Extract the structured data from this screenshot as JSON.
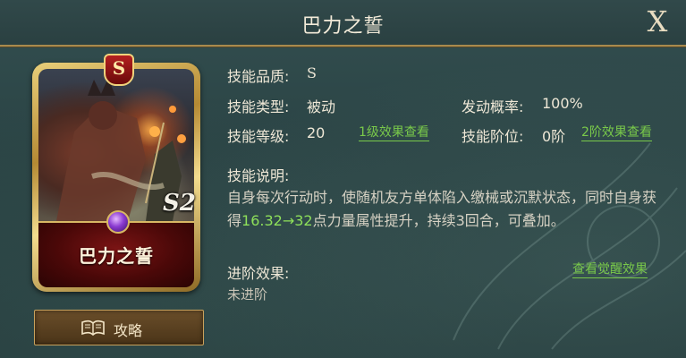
{
  "header": {
    "title": "巴力之誓",
    "close_label": "X"
  },
  "card": {
    "rank": "S",
    "name": "巴力之誓",
    "season": "S2"
  },
  "guide_button": {
    "label": "攻略"
  },
  "info": {
    "quality_label": "技能品质:",
    "quality_value": "S",
    "type_label": "技能类型:",
    "type_value": "被动",
    "level_label": "技能等级:",
    "level_value": "20",
    "level_link": "1级效果查看",
    "chance_label": "发动概率:",
    "chance_value": "100%",
    "tier_label": "技能阶位:",
    "tier_value": "0阶",
    "tier_link": "2阶效果查看",
    "desc_label": "技能说明:",
    "desc_part1": "自身每次行动时，使随机友方单体陷入缴械或沉默状态，同时自身获得",
    "desc_highlight": "16.32→32",
    "desc_part2": "点力量属性提升，持续3回合，可叠加。",
    "advance_label": "进阶效果:",
    "advance_value": "未进阶",
    "awaken_link": "查看觉醒效果"
  }
}
